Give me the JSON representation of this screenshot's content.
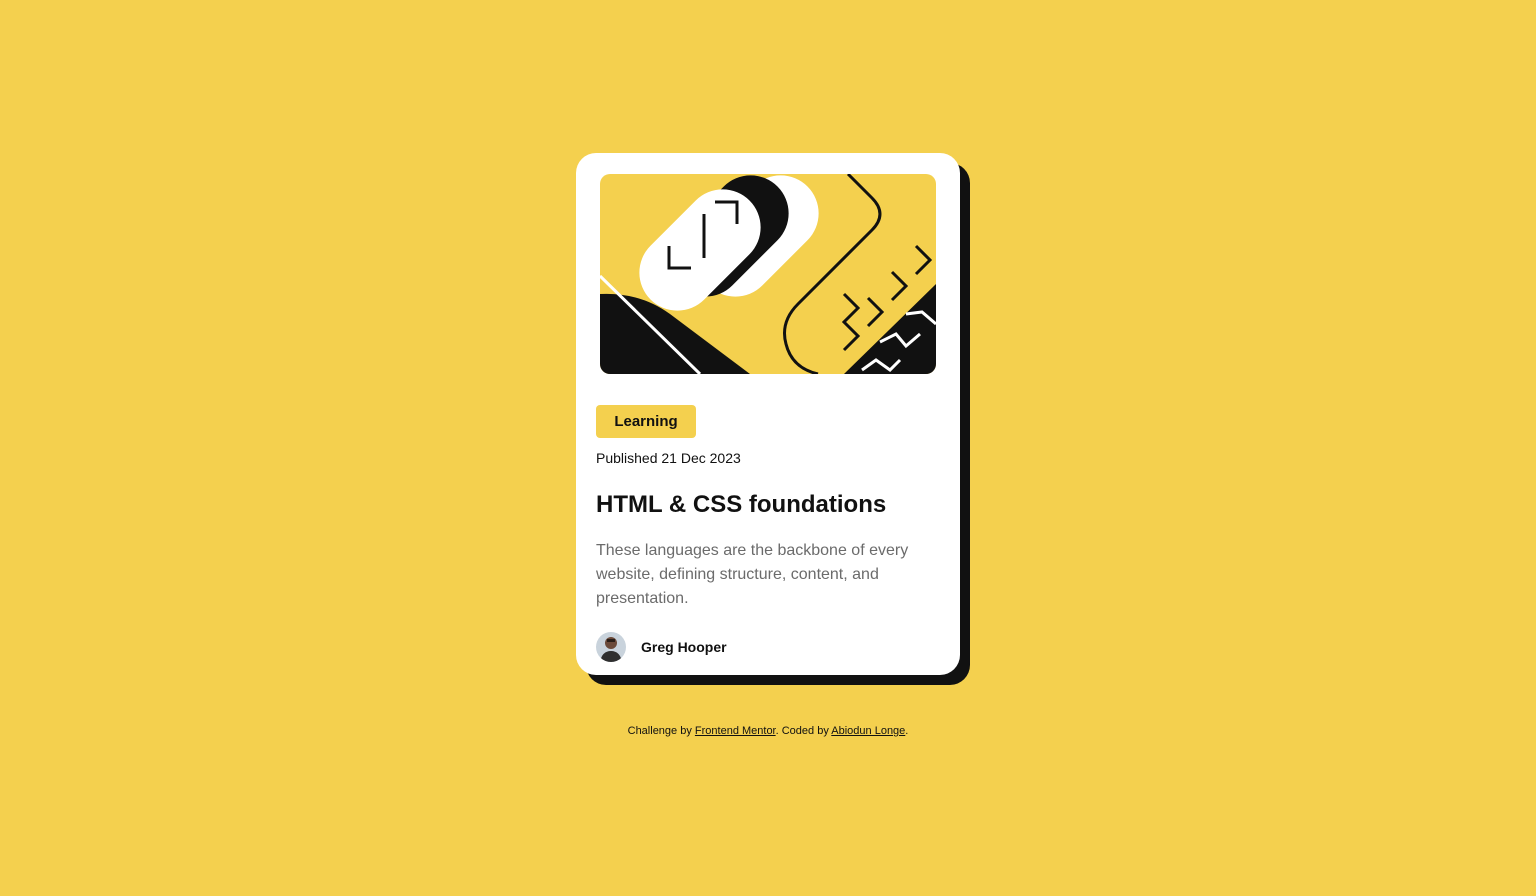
{
  "colors": {
    "background": "#F4D04E",
    "card": "#FFFFFF",
    "shadow": "#111111",
    "text": "#111111",
    "muted": "#6B6B6B",
    "tag": "#F4D04E"
  },
  "card": {
    "illustration_icon": "abstract-code-illustration",
    "tag_label": "Learning",
    "published": "Published 21 Dec 2023",
    "title": "HTML & CSS foundations",
    "description": "These languages are the backbone of every website, defining structure, content, and presentation.",
    "author": {
      "avatar_icon": "author-avatar",
      "name": "Greg Hooper"
    }
  },
  "attribution": {
    "prefix": "Challenge by ",
    "link1": "Frontend Mentor",
    "middle": ". Coded by ",
    "link2": "Abiodun Longe",
    "suffix": "."
  }
}
